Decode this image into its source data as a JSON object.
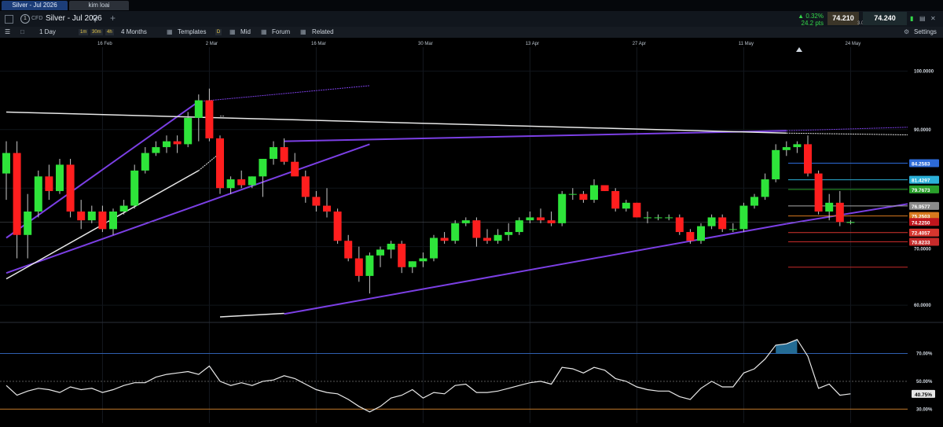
{
  "tabs": [
    {
      "label": "Silver - Jul 2026",
      "active": true
    },
    {
      "label": "kim loai",
      "active": false
    }
  ],
  "header": {
    "badge": "1",
    "market_type": "CFD",
    "instrument": "Silver - Jul 2026",
    "change_percent": "▲ 0.32%",
    "change_points": "24.2 pts",
    "bid": "74.210",
    "spread": "3.0",
    "ask": "74.240"
  },
  "toolbar": {
    "interval": "1 Day",
    "quick_intervals": [
      "1m",
      "30m",
      "4h"
    ],
    "range": "4 Months",
    "templates": "Templates",
    "d_button": "D",
    "price_type": "Mid",
    "forum": "Forum",
    "related": "Related",
    "settings": "Settings"
  },
  "colors": {
    "bull": "#2ee43a",
    "bear": "#ff1e1e",
    "trend_purple": "#7b3fe4",
    "trend_white": "#e8e8e8",
    "rsi_line": "#e8e8e8",
    "price_tag": "#c0161d"
  },
  "chart_data": {
    "type": "candlestick",
    "x_axis_labels": [
      {
        "label": "16 Feb",
        "index": 9
      },
      {
        "label": "2 Mar",
        "index": 19
      },
      {
        "label": "16 Mar",
        "index": 29
      },
      {
        "label": "30 Mar",
        "index": 39
      },
      {
        "label": "13 Apr",
        "index": 49
      },
      {
        "label": "27 Apr",
        "index": 59
      },
      {
        "label": "11 May",
        "index": 69
      },
      {
        "label": "24 May",
        "index": 79
      }
    ],
    "y_axis_labels": [
      "100.0000",
      "90.0000",
      "60.0000"
    ],
    "ylim": [
      58,
      103
    ],
    "candles": [
      {
        "o": 82.5,
        "h": 88,
        "l": 78,
        "c": 86
      },
      {
        "o": 86,
        "h": 88,
        "l": 68,
        "c": 72
      },
      {
        "o": 72,
        "h": 79,
        "l": 68,
        "c": 76
      },
      {
        "o": 76,
        "h": 83,
        "l": 75,
        "c": 82
      },
      {
        "o": 82,
        "h": 84,
        "l": 78,
        "c": 79.5
      },
      {
        "o": 79.5,
        "h": 85,
        "l": 79,
        "c": 84
      },
      {
        "o": 84,
        "h": 85,
        "l": 75,
        "c": 76
      },
      {
        "o": 76,
        "h": 78,
        "l": 73,
        "c": 74.5
      },
      {
        "o": 74.5,
        "h": 77,
        "l": 74,
        "c": 76
      },
      {
        "o": 76,
        "h": 77,
        "l": 72.5,
        "c": 73
      },
      {
        "o": 73,
        "h": 76.5,
        "l": 72,
        "c": 76
      },
      {
        "o": 76,
        "h": 78,
        "l": 75.5,
        "c": 77
      },
      {
        "o": 77,
        "h": 84,
        "l": 76.5,
        "c": 83
      },
      {
        "o": 83,
        "h": 87,
        "l": 82.5,
        "c": 86
      },
      {
        "o": 86,
        "h": 88,
        "l": 85.5,
        "c": 87
      },
      {
        "o": 87,
        "h": 89,
        "l": 86,
        "c": 88
      },
      {
        "o": 88,
        "h": 89,
        "l": 86,
        "c": 87.5
      },
      {
        "o": 87.5,
        "h": 93,
        "l": 87,
        "c": 92
      },
      {
        "o": 92,
        "h": 96,
        "l": 88,
        "c": 95
      },
      {
        "o": 95,
        "h": 97,
        "l": 88,
        "c": 88.5
      },
      {
        "o": 88.5,
        "h": 89,
        "l": 79,
        "c": 80
      },
      {
        "o": 80,
        "h": 82,
        "l": 79,
        "c": 81.5
      },
      {
        "o": 81.5,
        "h": 83,
        "l": 80,
        "c": 80.5
      },
      {
        "o": 80.5,
        "h": 82,
        "l": 80,
        "c": 82
      },
      {
        "o": 82,
        "h": 84,
        "l": 78.5,
        "c": 85
      },
      {
        "o": 85,
        "h": 88,
        "l": 84,
        "c": 87
      },
      {
        "o": 87,
        "h": 88.5,
        "l": 84,
        "c": 84.5
      },
      {
        "o": 84.5,
        "h": 86,
        "l": 83,
        "c": 82
      },
      {
        "o": 82,
        "h": 83,
        "l": 77.5,
        "c": 78.5
      },
      {
        "o": 78.5,
        "h": 79.5,
        "l": 76,
        "c": 77
      },
      {
        "o": 77,
        "h": 80,
        "l": 75,
        "c": 76
      },
      {
        "o": 76,
        "h": 76.5,
        "l": 70.5,
        "c": 71
      },
      {
        "o": 71,
        "h": 72,
        "l": 67.5,
        "c": 68
      },
      {
        "o": 68,
        "h": 70,
        "l": 64,
        "c": 65
      },
      {
        "o": 65,
        "h": 69,
        "l": 62,
        "c": 68.5
      },
      {
        "o": 68.5,
        "h": 70,
        "l": 66.5,
        "c": 69.5
      },
      {
        "o": 69.5,
        "h": 71,
        "l": 68,
        "c": 70.5
      },
      {
        "o": 70.5,
        "h": 71,
        "l": 65.5,
        "c": 66.5
      },
      {
        "o": 66.5,
        "h": 67.5,
        "l": 65.5,
        "c": 67.5
      },
      {
        "o": 67.5,
        "h": 69,
        "l": 66.5,
        "c": 68
      },
      {
        "o": 68,
        "h": 72,
        "l": 67.5,
        "c": 71.5
      },
      {
        "o": 71.5,
        "h": 72.5,
        "l": 70.5,
        "c": 71
      },
      {
        "o": 71,
        "h": 74.5,
        "l": 70.5,
        "c": 74
      },
      {
        "o": 74,
        "h": 75,
        "l": 73.5,
        "c": 74.5
      },
      {
        "o": 74.5,
        "h": 75,
        "l": 70,
        "c": 71.5
      },
      {
        "o": 71.5,
        "h": 73,
        "l": 70.5,
        "c": 71
      },
      {
        "o": 71,
        "h": 73,
        "l": 70.5,
        "c": 72
      },
      {
        "o": 72,
        "h": 74,
        "l": 71,
        "c": 72.5
      },
      {
        "o": 72.5,
        "h": 75,
        "l": 72,
        "c": 74.5
      },
      {
        "o": 74.5,
        "h": 76,
        "l": 74,
        "c": 75
      },
      {
        "o": 75,
        "h": 76.5,
        "l": 74,
        "c": 74.5
      },
      {
        "o": 74.5,
        "h": 76,
        "l": 73.5,
        "c": 74
      },
      {
        "o": 74,
        "h": 79.5,
        "l": 73.5,
        "c": 79
      },
      {
        "o": 79,
        "h": 80,
        "l": 78,
        "c": 79
      },
      {
        "o": 79,
        "h": 79.5,
        "l": 77.5,
        "c": 78
      },
      {
        "o": 78,
        "h": 81.5,
        "l": 77.5,
        "c": 80.5
      },
      {
        "o": 80.5,
        "h": 80.5,
        "l": 79.5,
        "c": 79.5
      },
      {
        "o": 79.5,
        "h": 80,
        "l": 76,
        "c": 76.5
      },
      {
        "o": 76.5,
        "h": 78,
        "l": 76,
        "c": 77.5
      },
      {
        "o": 77.5,
        "h": 77.5,
        "l": 75,
        "c": 75
      },
      {
        "o": 75,
        "h": 76,
        "l": 74,
        "c": 75
      },
      {
        "o": 75,
        "h": 75.5,
        "l": 74.5,
        "c": 75
      },
      {
        "o": 75,
        "h": 75.5,
        "l": 74.5,
        "c": 75
      },
      {
        "o": 75,
        "h": 75.5,
        "l": 72,
        "c": 72.5
      },
      {
        "o": 72.5,
        "h": 73,
        "l": 70.5,
        "c": 71
      },
      {
        "o": 71,
        "h": 74,
        "l": 70.5,
        "c": 73.5
      },
      {
        "o": 73.5,
        "h": 75.5,
        "l": 73,
        "c": 75
      },
      {
        "o": 75,
        "h": 75.5,
        "l": 72.5,
        "c": 73
      },
      {
        "o": 73,
        "h": 74,
        "l": 72.5,
        "c": 73
      },
      {
        "o": 73,
        "h": 77.5,
        "l": 72.5,
        "c": 77
      },
      {
        "o": 77,
        "h": 79,
        "l": 76.5,
        "c": 78.5
      },
      {
        "o": 78.5,
        "h": 82.5,
        "l": 78,
        "c": 81.5
      },
      {
        "o": 81.5,
        "h": 87.5,
        "l": 81,
        "c": 86.5
      },
      {
        "o": 86.5,
        "h": 88,
        "l": 85.5,
        "c": 87
      },
      {
        "o": 87,
        "h": 88,
        "l": 86,
        "c": 87.5
      },
      {
        "o": 87.5,
        "h": 89,
        "l": 82,
        "c": 82.5
      },
      {
        "o": 82.5,
        "h": 83,
        "l": 75.5,
        "c": 76
      },
      {
        "o": 76,
        "h": 79,
        "l": 74.5,
        "c": 77.5
      },
      {
        "o": 77.5,
        "h": 79.5,
        "l": 73.5,
        "c": 74.2
      },
      {
        "o": 74.2,
        "h": 74.5,
        "l": 73.8,
        "c": 74.2
      }
    ],
    "price_tags": [
      {
        "label": "84.2583",
        "value": 84.26,
        "color": "#2d6bd8"
      },
      {
        "label": "81.4297",
        "value": 81.43,
        "color": "#2bb0d8"
      },
      {
        "label": "79.7673",
        "value": 79.77,
        "color": "#2aa02b"
      },
      {
        "label": "76.9577",
        "value": 76.96,
        "color": "#8a8a8a"
      },
      {
        "label": "75.2503",
        "value": 75.25,
        "color": "#d97a1e"
      },
      {
        "label": "74.2250",
        "value": 74.22,
        "color": "#c0161d"
      },
      {
        "label": "72.4057",
        "value": 72.41,
        "color": "#d7362f"
      },
      {
        "label": "70.8233",
        "value": 70.82,
        "color": "#c72b2b"
      }
    ],
    "price_line_value": 74.22,
    "tag_label_70": "70.0000",
    "fib_lines": [
      {
        "value": 84.26,
        "color": "#2d6bd8"
      },
      {
        "value": 81.43,
        "color": "#2bb0d8"
      },
      {
        "value": 79.77,
        "color": "#2aa02b"
      },
      {
        "value": 76.96,
        "color": "#aaaaaa"
      },
      {
        "value": 75.25,
        "color": "#d97a1e"
      },
      {
        "value": 72.41,
        "color": "#d7362f"
      },
      {
        "value": 70.82,
        "color": "#c72b2b"
      },
      {
        "value": 66.5,
        "color": "#c72b2b"
      }
    ],
    "rsi": {
      "levels": [
        "70.00%",
        "50.00%",
        "30.00%"
      ],
      "current_label": "40.75%",
      "values": [
        47,
        40,
        43,
        45,
        44,
        42,
        46,
        44,
        45,
        42,
        44,
        47,
        49,
        49,
        53,
        55,
        56,
        57,
        55,
        61,
        50,
        47,
        49,
        47,
        50,
        51,
        54,
        52,
        48,
        44,
        42,
        41,
        37,
        32,
        28,
        32,
        38,
        40,
        44,
        38,
        42,
        41,
        47,
        48,
        42,
        42,
        43,
        45,
        47,
        49,
        50,
        48,
        60,
        59,
        56,
        60,
        58,
        52,
        50,
        46,
        44,
        43,
        43,
        39,
        37,
        45,
        50,
        46,
        46,
        56,
        59,
        66,
        76,
        77,
        80,
        68,
        45,
        48,
        40,
        41
      ]
    }
  }
}
